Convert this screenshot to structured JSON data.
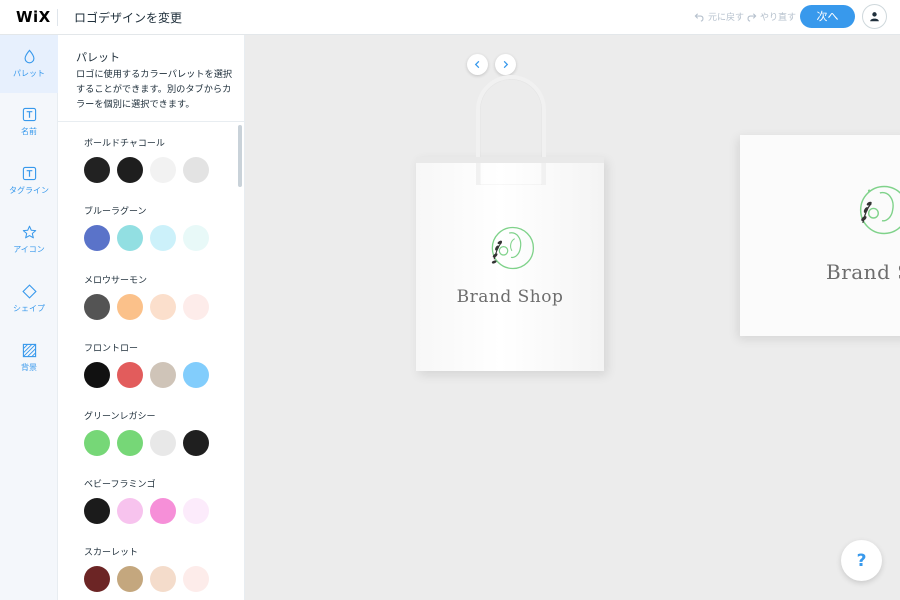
{
  "header": {
    "logo": "WiX",
    "title": "ロゴデザインを変更",
    "undo_label": "元に戻す",
    "redo_label": "やり直す",
    "next_label": "次へ",
    "user_icon": "user-icon"
  },
  "sidebar": {
    "items": [
      {
        "label": "パレット",
        "icon": "droplet-icon",
        "active": true
      },
      {
        "label": "名前",
        "icon": "text-icon",
        "active": false
      },
      {
        "label": "タグライン",
        "icon": "text-icon",
        "active": false
      },
      {
        "label": "アイコン",
        "icon": "star-icon",
        "active": false
      },
      {
        "label": "シェイプ",
        "icon": "diamond-icon",
        "active": false
      },
      {
        "label": "背景",
        "icon": "pattern-icon",
        "active": false
      }
    ]
  },
  "panel": {
    "title": "パレット",
    "description": "ロゴに使用するカラーパレットを選択することができます。別のタブからカラーを個別に選択できます。",
    "palettes": [
      {
        "name": "ボールドチャコール",
        "colors": [
          "#222222",
          "#1e1e1e",
          "#f2f2f2",
          "#e3e3e3"
        ]
      },
      {
        "name": "ブルーラグーン",
        "colors": [
          "#5a73c9",
          "#92dfe2",
          "#ccf1fa",
          "#e8f9f8"
        ]
      },
      {
        "name": "メロウサーモン",
        "colors": [
          "#545454",
          "#fbc18a",
          "#fbdfcc",
          "#fdecea"
        ]
      },
      {
        "name": "フロントロー",
        "colors": [
          "#111111",
          "#e25c5c",
          "#cfc4b8",
          "#82cdfc"
        ]
      },
      {
        "name": "グリーンレガシー",
        "colors": [
          "#76d777",
          "#76d777",
          "#e8e8e8",
          "#1f1f1f"
        ]
      },
      {
        "name": "ベビーフラミンゴ",
        "colors": [
          "#1b1b1b",
          "#f7c3ee",
          "#f68fd8",
          "#fcebfb"
        ]
      },
      {
        "name": "スカーレット",
        "colors": [
          "#6c2525",
          "#c4a77e",
          "#f4dccb",
          "#fdecea"
        ]
      }
    ]
  },
  "preview": {
    "bag_brand": "Brand Shop",
    "card_brand": "Brand Shop",
    "prev_icon": "chevron-left-icon",
    "next_icon": "chevron-right-icon",
    "help_label": "?"
  },
  "colors": {
    "accent": "#3899ec",
    "emblem_green": "#7fd28a",
    "emblem_leaf": "#333333"
  }
}
